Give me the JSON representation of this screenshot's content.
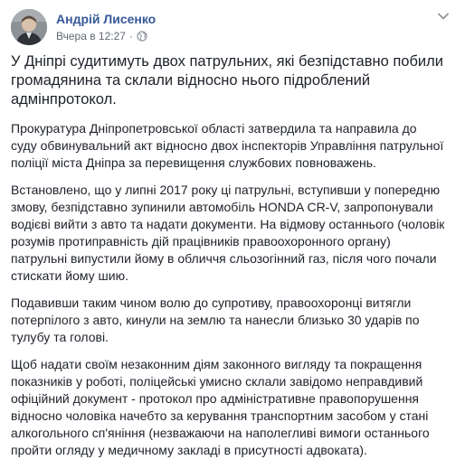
{
  "post": {
    "author": "Андрій Лисенко",
    "timestamp": "Вчера в 12:27",
    "separator": "·",
    "privacy_icon": "globe-icon",
    "more_icon": "chevron-down-icon",
    "paragraphs": [
      "У Дніпрі судитимуть двох патрульних, які безпідставно побили громадянина та склали відносно нього підроблений адмінпротокол.",
      "Прокуратура Дніпропетровської області затвердила та направила до суду обвинувальний акт відносно двох інспекторів Управління патрульної поліції міста Дніпра за перевищення службових повноважень.",
      "Встановлено, що у липні 2017 року ці патрульні, вступивши у попередню змову, безпідставно зупинили автомобіль HONDA CR-V, запропонували водієві вийти з авто та надати документи. На відмову останнього (чоловік розумів протиправність дій працівників правоохоронного органу) патрульні випустили йому в обличчя сльозогінний газ, після чого почали стискати йому шию.",
      "Подавивши таким чином волю до супротиву, правоохоронці витягли потерпілого з авто, кинули на землю та нанесли близько 30 ударів по тулубу та голові.",
      "Щоб надати своїм незаконним діям законного вигляду та покращення показників у роботі, поліцейські умисно склали завідомо неправдивий офіційний документ - протокол про адміністративне правопорушення відносно чоловіка начебто за керування транспортним засобом у стані алкогольного сп'яніння (незважаючи на наполегливі вимоги останнього пройти огляду у медичному закладі в присутності адвоката)."
    ]
  },
  "colors": {
    "author_link": "#365899",
    "meta_text": "#616770",
    "body_text": "#1d2129"
  }
}
